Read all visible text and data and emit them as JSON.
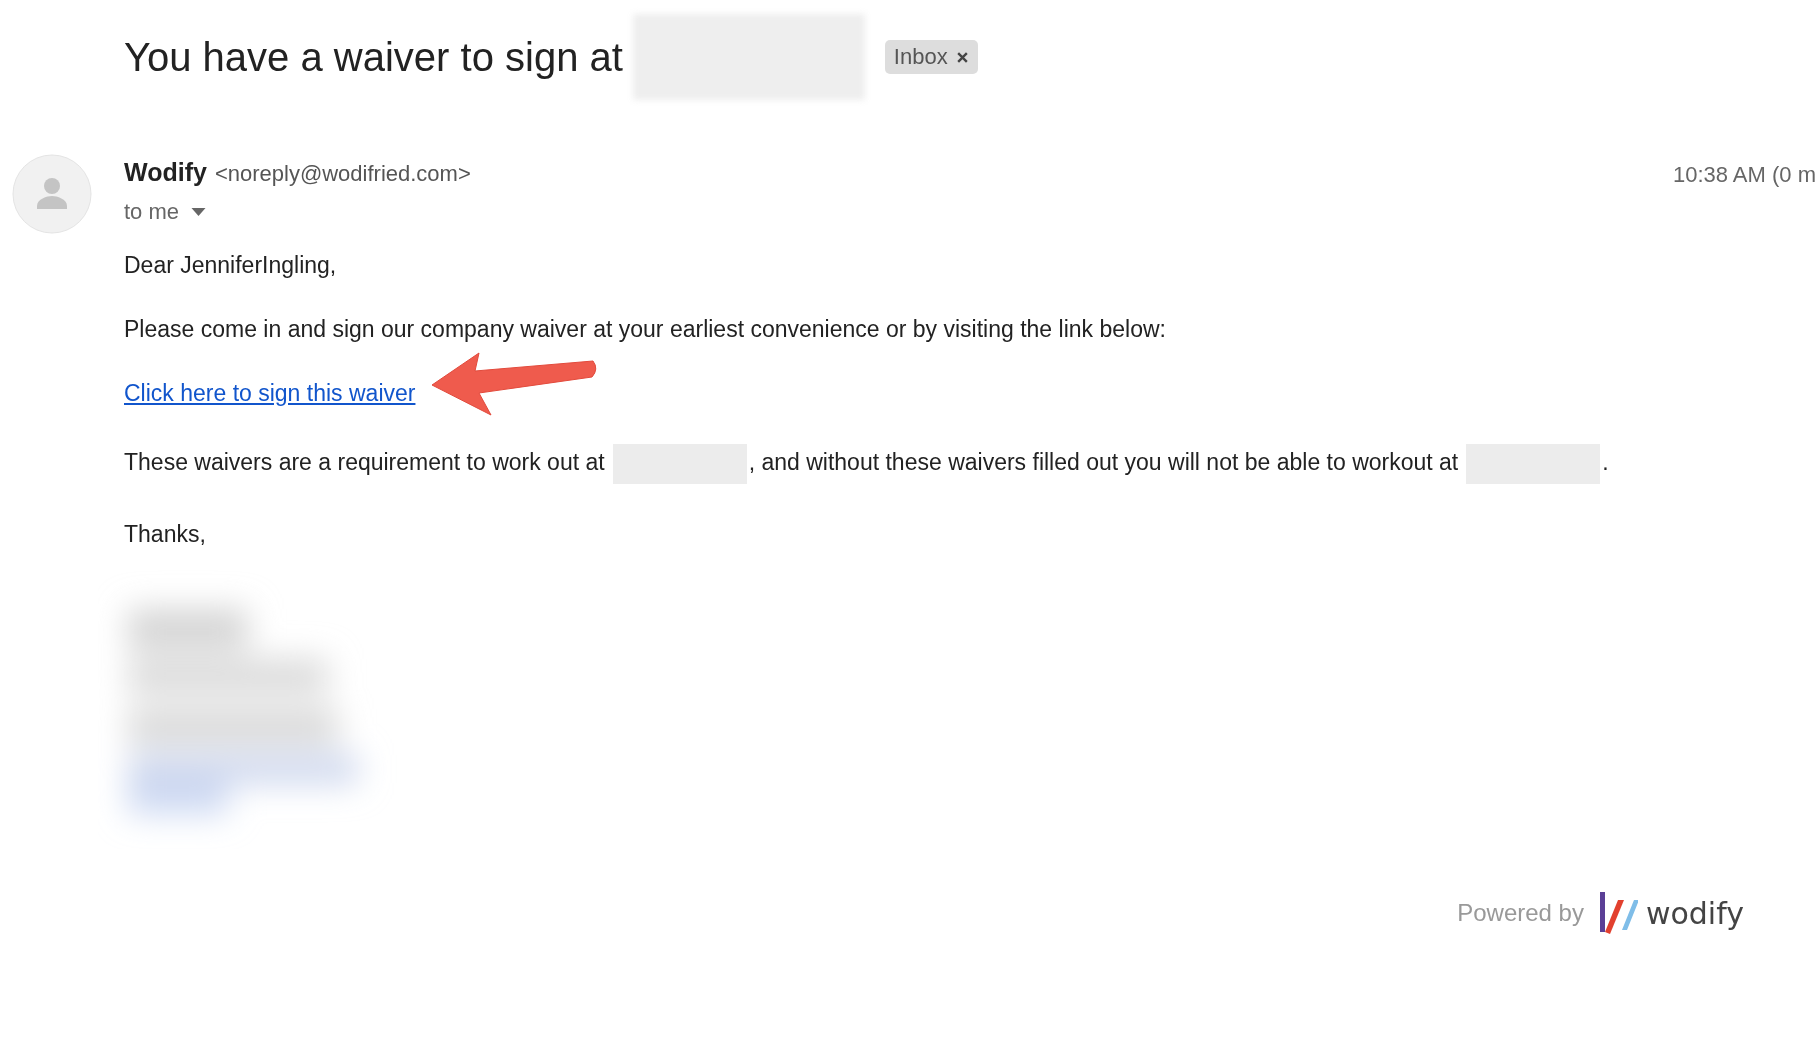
{
  "subject": {
    "title": "You have a waiver to sign at",
    "label": "Inbox"
  },
  "message": {
    "sender_name": "Wodify",
    "sender_email": "<noreply@wodifried.com>",
    "recipient": "to me",
    "time": "10:38 AM (0 m"
  },
  "body": {
    "greeting": "Dear JenniferIngling,",
    "intro": "Please come in and sign our company waiver at your earliest convenience or by visiting the link below:",
    "link": "Click here to sign this waiver",
    "notice_parts": [
      "These waivers are a requirement to work out at",
      ", and without these waivers filled out you will not be able to workout at",
      "."
    ],
    "closing": "Thanks,"
  },
  "footer": {
    "powered_by": "Powered by",
    "brand": "wodify"
  }
}
